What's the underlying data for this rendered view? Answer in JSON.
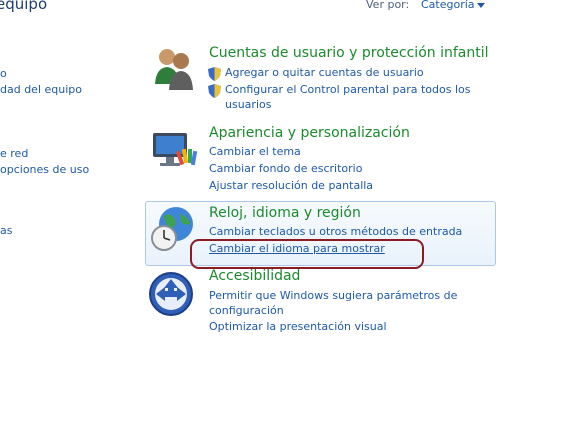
{
  "header": {
    "title": "equipo",
    "view_by_label": "Ver por:",
    "view_by_value": "Categoría"
  },
  "sidebar": {
    "items": [
      "o",
      "dad del equipo",
      "e red",
      "opciones de uso",
      "as"
    ]
  },
  "categories": [
    {
      "title": "Cuentas de usuario y protección infantil",
      "links": [
        "Agregar o quitar cuentas de usuario",
        "Configurar el Control parental para todos los",
        "usuarios"
      ]
    },
    {
      "title": "Apariencia y personalización",
      "links": [
        "Cambiar el tema",
        "Cambiar fondo de escritorio",
        "Ajustar resolución de pantalla"
      ]
    },
    {
      "title": "Reloj, idioma y región",
      "links": [
        "Cambiar teclados u otros métodos de entrada",
        "Cambiar el idioma para mostrar"
      ]
    },
    {
      "title": "Accesibilidad",
      "links": [
        "Permitir que Windows sugiera parámetros de",
        "configuración",
        "Optimizar la presentación visual"
      ]
    }
  ],
  "icons": {
    "users": "users-icon",
    "appearance": "monitor-paint-icon",
    "clock": "globe-clock-icon",
    "accessibility": "accessibility-icon",
    "shield": "uac-shield-icon"
  },
  "colors": {
    "heading": "#1c8a2c",
    "link": "#1e5aa8",
    "annotation": "#8a1c24"
  }
}
